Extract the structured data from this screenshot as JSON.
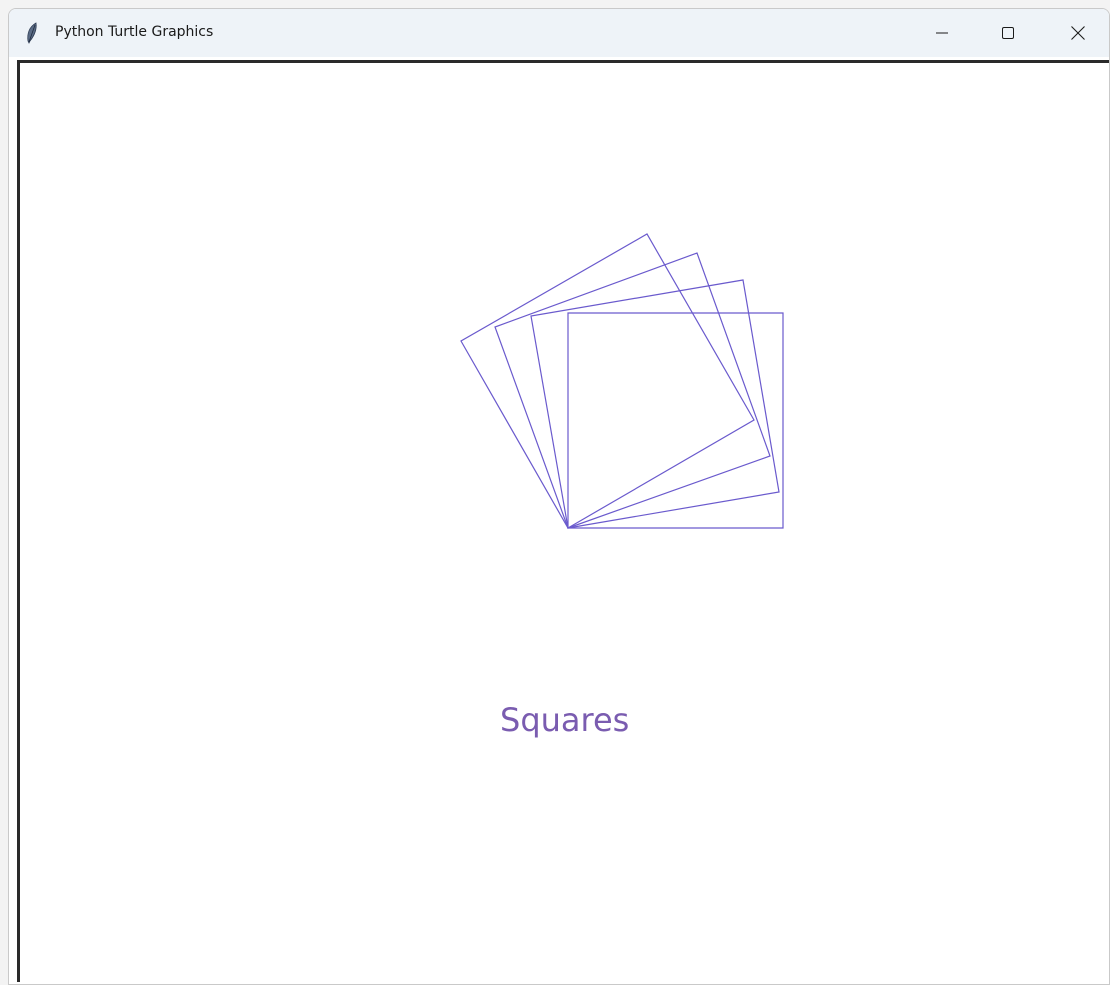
{
  "window": {
    "title": "Python Turtle Graphics",
    "controls": {
      "minimize": "minimize-icon",
      "maximize": "maximize-icon",
      "close": "close-icon"
    },
    "app_icon": "feather-icon"
  },
  "canvas": {
    "label": "Squares",
    "label_color": "#7a5cb0",
    "pen_color": "#6a5acd",
    "background": "#ffffff"
  }
}
